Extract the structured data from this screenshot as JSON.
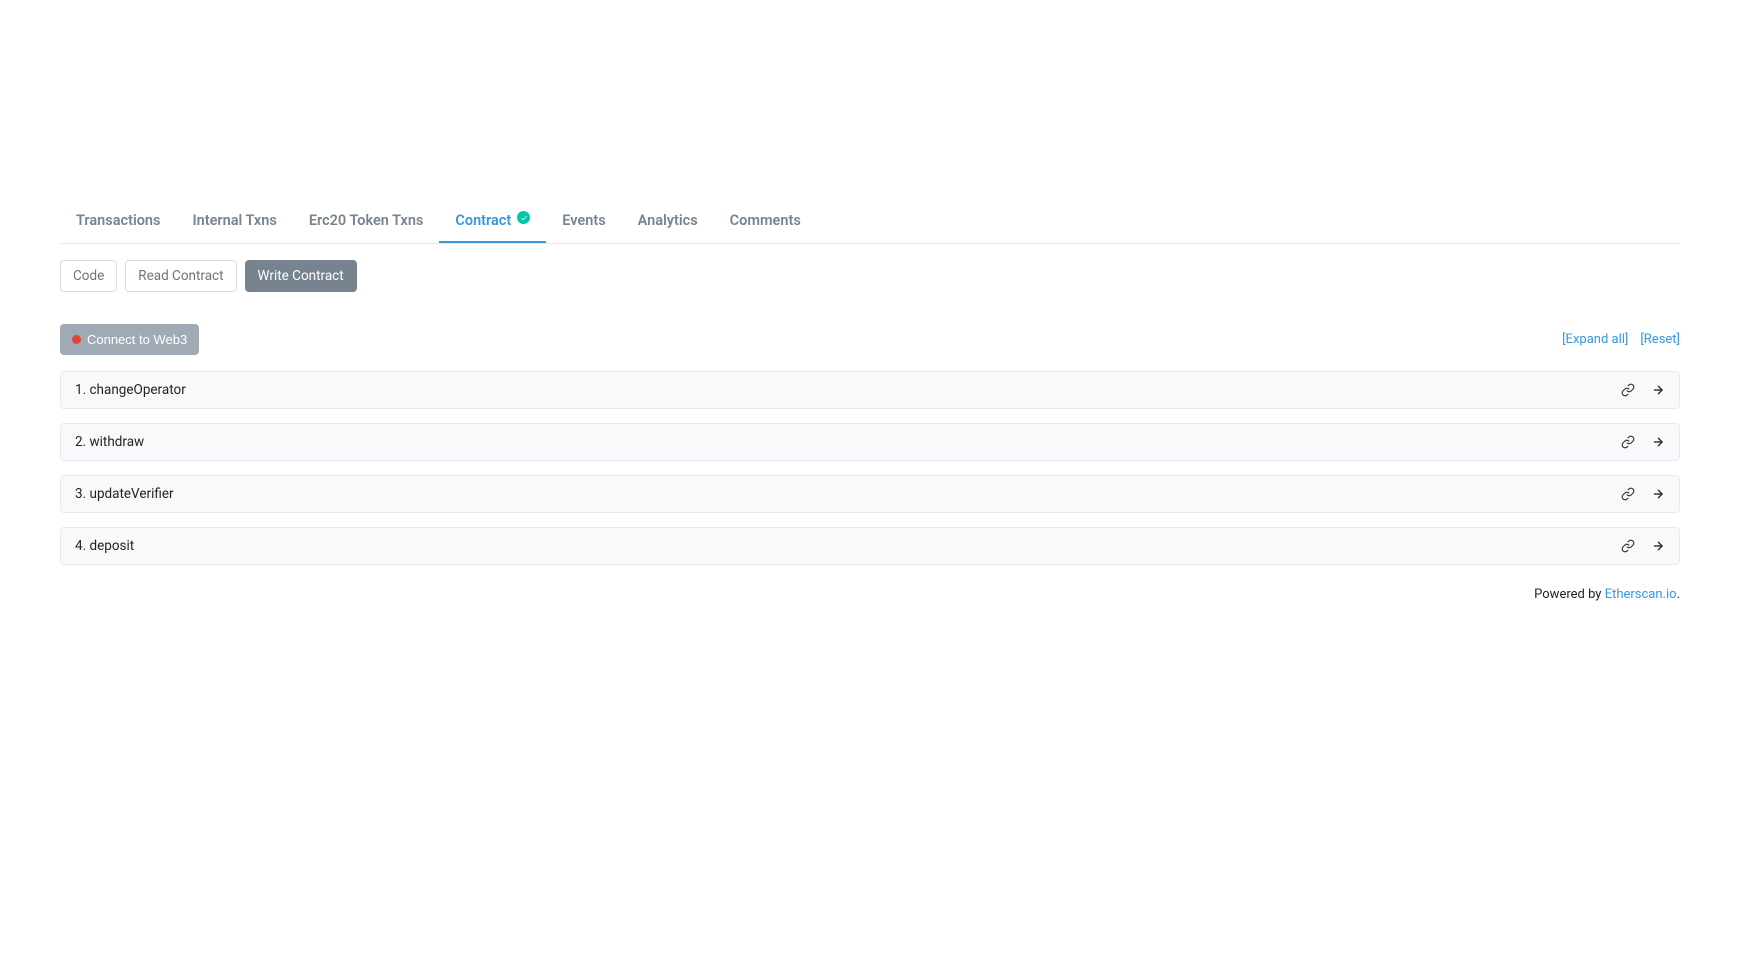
{
  "tabs": {
    "transactions": "Transactions",
    "internal_txns": "Internal Txns",
    "erc20_token_txns": "Erc20 Token Txns",
    "contract": "Contract",
    "events": "Events",
    "analytics": "Analytics",
    "comments": "Comments"
  },
  "subtabs": {
    "code": "Code",
    "read_contract": "Read Contract",
    "write_contract": "Write Contract"
  },
  "connect": {
    "label": "Connect to Web3"
  },
  "actions": {
    "expand_all": "[Expand all]",
    "reset": "[Reset]"
  },
  "functions": [
    {
      "label": "1. changeOperator"
    },
    {
      "label": "2. withdraw"
    },
    {
      "label": "3. updateVerifier"
    },
    {
      "label": "4. deposit"
    }
  ],
  "footer": {
    "powered_by": "Powered by ",
    "link": "Etherscan.io",
    "suffix": "."
  }
}
